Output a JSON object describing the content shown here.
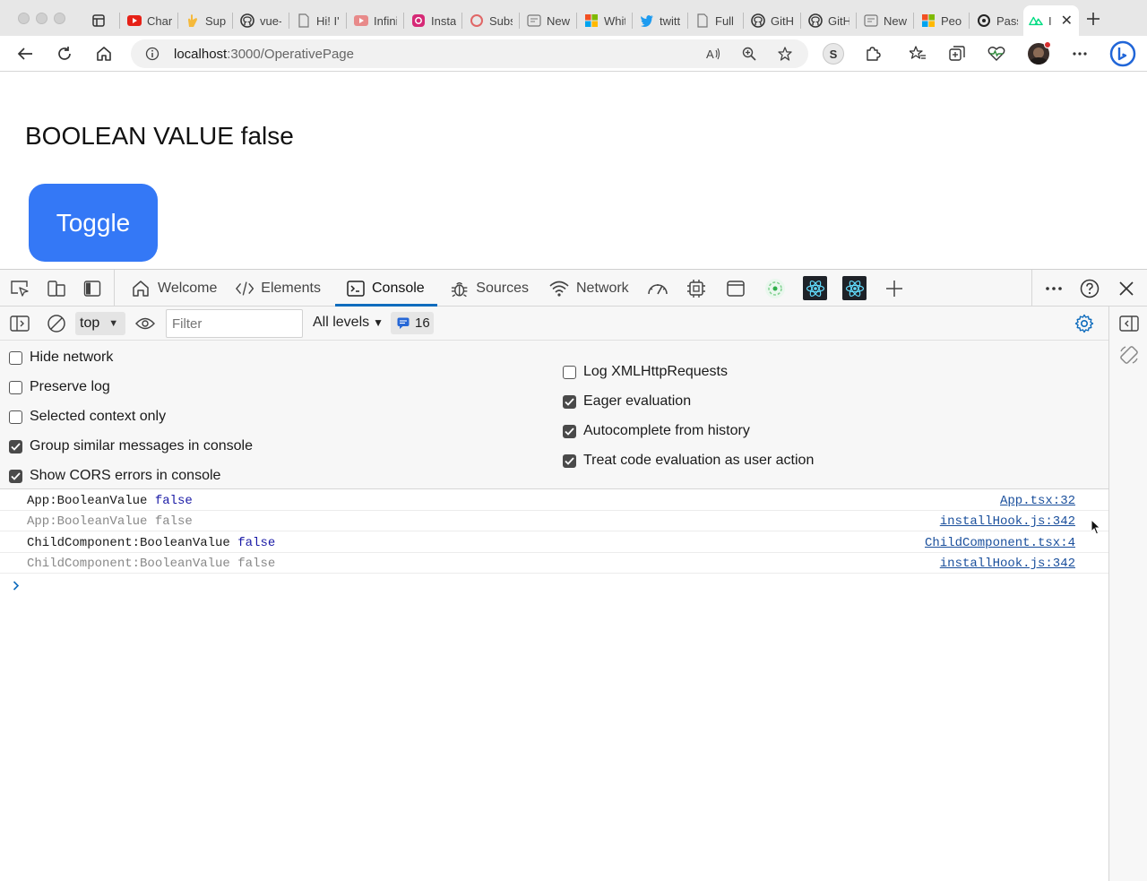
{
  "browser": {
    "tabs": [
      {
        "title": "",
        "icon": "tab-actions-icon"
      },
      {
        "title": "Char",
        "icon": "youtube-icon"
      },
      {
        "title": "Supp",
        "icon": "hand-icon"
      },
      {
        "title": "vue-",
        "icon": "github-icon"
      },
      {
        "title": "Hi! I'",
        "icon": "document-icon"
      },
      {
        "title": "Infini",
        "icon": "youtube-icon"
      },
      {
        "title": "Insta",
        "icon": "instagram-icon"
      },
      {
        "title": "Subs",
        "icon": "circle-icon"
      },
      {
        "title": "New",
        "icon": "newtab-icon"
      },
      {
        "title": "Whit",
        "icon": "microsoft-icon"
      },
      {
        "title": "twitt",
        "icon": "twitter-icon"
      },
      {
        "title": "Full",
        "icon": "document-icon"
      },
      {
        "title": "GitH",
        "icon": "github-icon"
      },
      {
        "title": "GitH",
        "icon": "github-icon"
      },
      {
        "title": "New",
        "icon": "newtab-icon"
      },
      {
        "title": "Peop",
        "icon": "microsoft-icon"
      },
      {
        "title": "Pass",
        "icon": "openai-icon"
      },
      {
        "title": "I",
        "icon": "nuxt-icon"
      }
    ],
    "url_host": "localhost",
    "url_path": ":3000/OperativePage",
    "profile_letter": "S"
  },
  "page": {
    "heading": "BOOLEAN VALUE false",
    "toggle_label": "Toggle"
  },
  "devtools": {
    "tabs": {
      "welcome": "Welcome",
      "elements": "Elements",
      "console": "Console",
      "sources": "Sources",
      "network": "Network"
    },
    "console_toolbar": {
      "context": "top",
      "filter_placeholder": "Filter",
      "levels": "All levels",
      "message_count": "16"
    },
    "settings_left": [
      {
        "label": "Hide network",
        "checked": false
      },
      {
        "label": "Preserve log",
        "checked": false
      },
      {
        "label": "Selected context only",
        "checked": false
      },
      {
        "label": "Group similar messages in console",
        "checked": true
      },
      {
        "label": "Show CORS errors in console",
        "checked": true
      }
    ],
    "settings_right": [
      {
        "label": "Log XMLHttpRequests",
        "checked": false
      },
      {
        "label": "Eager evaluation",
        "checked": true
      },
      {
        "label": "Autocomplete from history",
        "checked": true
      },
      {
        "label": "Treat code evaluation as user action",
        "checked": true
      }
    ],
    "logs": [
      {
        "text": "App:BooleanValue ",
        "value": "false",
        "source": "App.tsx:32",
        "dim": false
      },
      {
        "text": "App:BooleanValue ",
        "value": "false",
        "source": "installHook.js:342",
        "dim": true
      },
      {
        "text": "ChildComponent:BooleanValue ",
        "value": "false",
        "source": "ChildComponent.tsx:4",
        "dim": false
      },
      {
        "text": "ChildComponent:BooleanValue ",
        "value": "false",
        "source": "installHook.js:342",
        "dim": true
      }
    ]
  },
  "colors": {
    "toggle_bg": "#3478f6",
    "console_accent": "#0f6cbd",
    "link": "#1a4f9c",
    "value": "#1a1aa6"
  }
}
